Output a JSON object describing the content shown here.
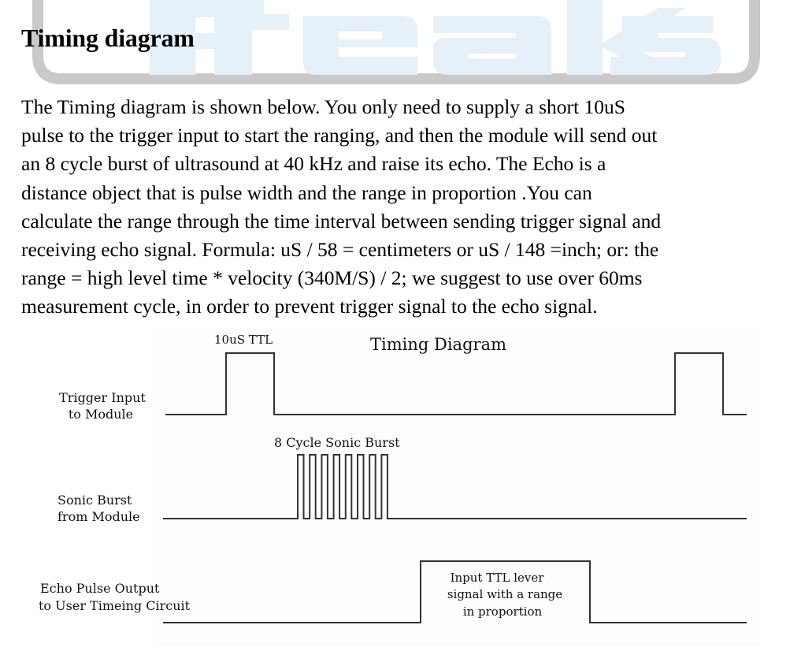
{
  "watermark": {
    "text": "Freaks",
    "text_color": "#e8f1f8",
    "frame_color": "#c7c7c7"
  },
  "section": {
    "heading": "Timing diagram",
    "paragraph_lines": [
      "The Timing diagram is shown below. You only need to supply a short 10uS",
      "pulse to the trigger input to start the ranging, and then the module will send out",
      "an 8 cycle burst of ultrasound at 40 kHz and raise its echo. The Echo is a",
      "distance object that is pulse width and the range in proportion .You can",
      "calculate the range through the time interval between sending trigger signal and",
      "receiving echo signal. Formula: uS / 58 = centimeters or uS / 148 =inch; or: the",
      "range = high level time * velocity (340M/S) / 2; we suggest to use over 60ms",
      "measurement cycle, in order to prevent trigger signal to the echo signal."
    ]
  },
  "diagram": {
    "title": "Timing Diagram",
    "line_color": "#333333",
    "signals": {
      "trigger": {
        "label_line1": "Trigger Input",
        "label_line2": "to Module",
        "pulse_label": "10uS TTL"
      },
      "sonic": {
        "label_line1": "Sonic Burst",
        "label_line2": "from Module",
        "pulse_label": "8 Cycle Sonic Burst",
        "cycles": 8
      },
      "echo": {
        "label_line1": "Echo Pulse Output",
        "label_line2": "to User Timeing Circuit",
        "pulse_text_line1": "Input TTL lever",
        "pulse_text_line2": "signal with a range",
        "pulse_text_line3": "in proportion"
      }
    }
  }
}
